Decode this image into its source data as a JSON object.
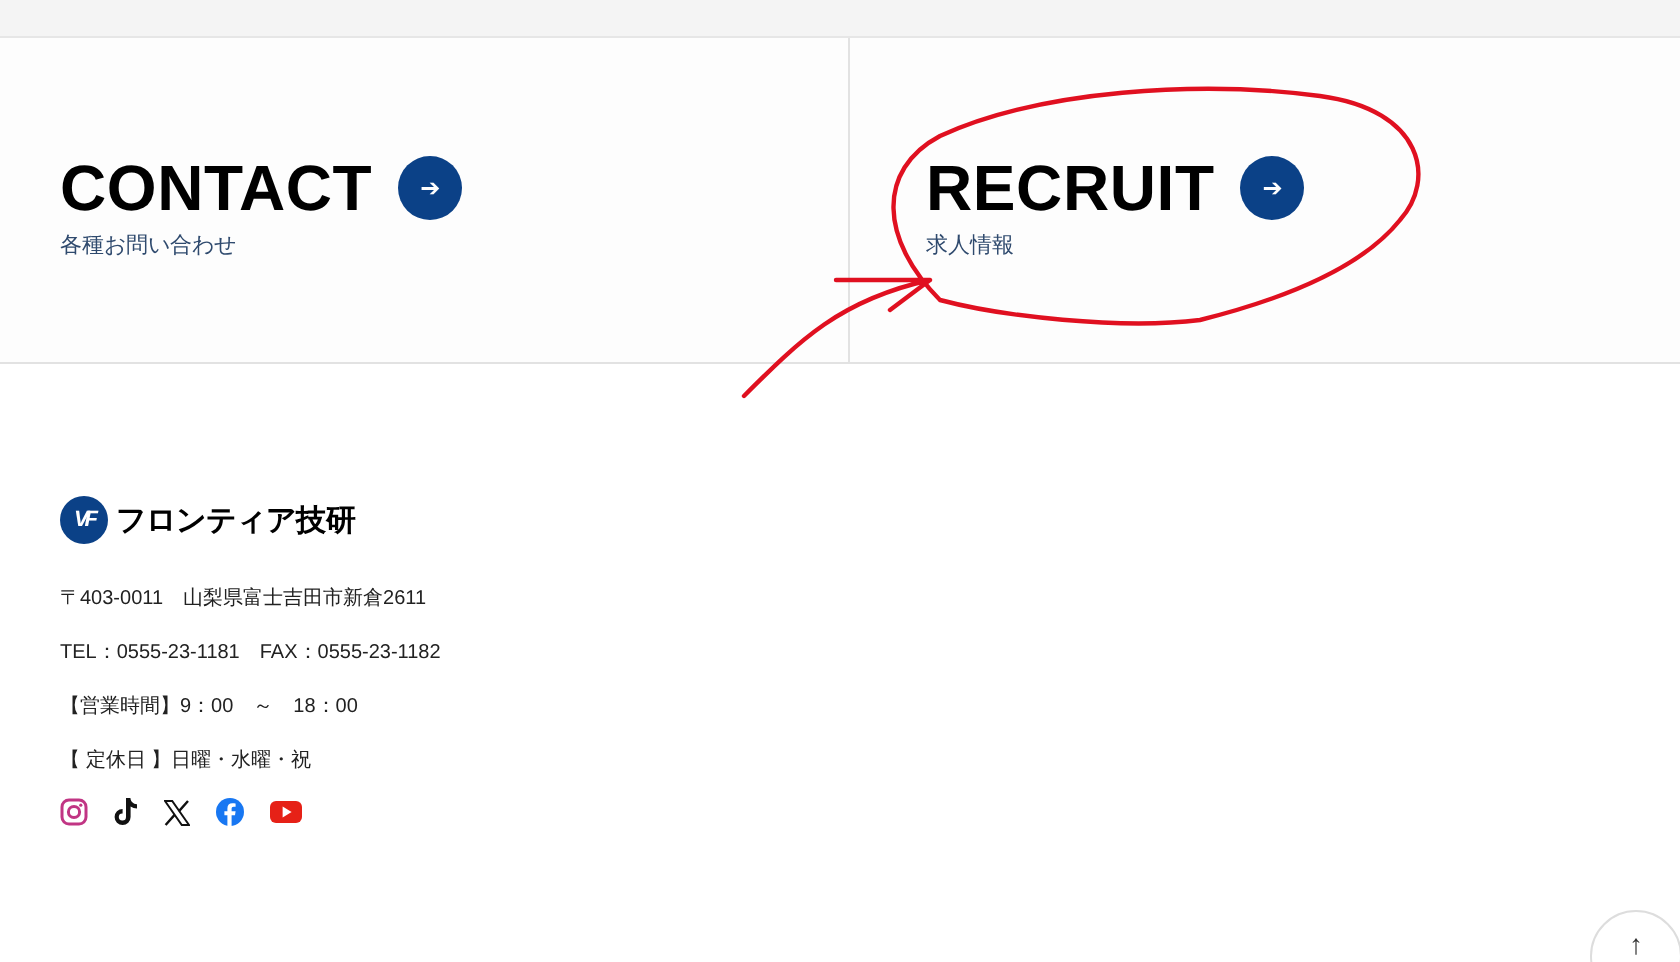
{
  "cards": [
    {
      "title": "CONTACT",
      "subtitle": "各種お問い合わせ",
      "arrow": "➔"
    },
    {
      "title": "RECRUIT",
      "subtitle": "求人情報",
      "arrow": "➔"
    }
  ],
  "footer": {
    "logo_mark": "VF",
    "company": "フロンティア技研",
    "lines": [
      "〒403-0011　山梨県富士吉田市新倉2611",
      "TEL：0555-23-1181　FAX：0555-23-1182",
      "【営業時間】9：00　～　18：00",
      "【 定休日 】日曜・水曜・祝"
    ],
    "social": [
      {
        "kind": "instagram"
      },
      {
        "kind": "tiktok"
      },
      {
        "kind": "x"
      },
      {
        "kind": "facebook"
      },
      {
        "kind": "youtube"
      }
    ]
  },
  "scroll_top": "↑"
}
